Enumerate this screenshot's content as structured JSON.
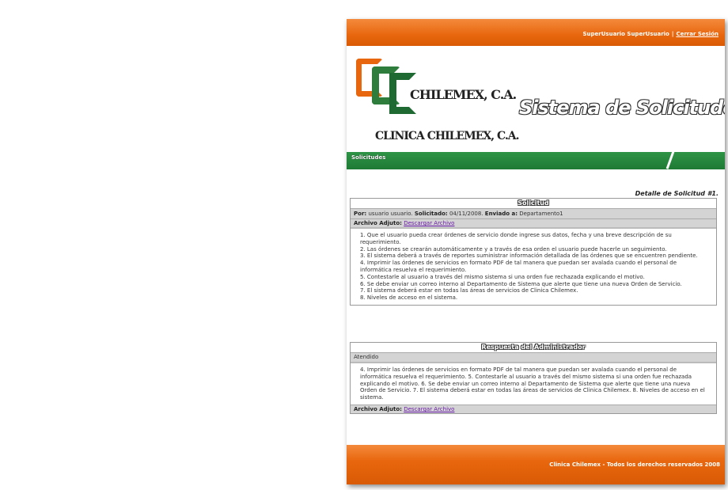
{
  "topbar": {
    "user": "SuperUsuario SuperUsuario",
    "separator": "|",
    "logout": "Cerrar Sesión"
  },
  "header": {
    "logo_name": "CHILEMEX, C.A.",
    "logo_sub": "CLINICA CHILEMEX, C.A.",
    "title": "Sistema de Solicitudes"
  },
  "nav": {
    "tab": "Solicitudes"
  },
  "detail": {
    "title": "Detalle de Solicitud #1.",
    "request_heading": "Solicitud",
    "por_label": "Por:",
    "por_value": "usuario usuario.",
    "solicitado_label": "Solicitado:",
    "solicitado_value": "04/11/2008.",
    "enviado_label": "Enviado a:",
    "enviado_value": "Departamento1",
    "attach_label": "Archivo Adjuto:",
    "attach_link": "Descargar Archivo",
    "request_lines": [
      "1. Que el usuario pueda crear órdenes de servicio donde ingrese sus datos, fecha y una breve descripción de su requerimiento.",
      "2. Las órdenes se crearán automáticamente y a través de esa orden el usuario puede hacerle un seguimiento.",
      "3. El sistema deberá a través de reportes suministrar información detallada de las órdenes que se encuentren pendiente.",
      "4. Imprimir las órdenes de servicios en formato PDF de tal manera que puedan ser avalada cuando el personal de informática resuelva el requerimiento.",
      "5. Contestarle al usuario a través del mismo sistema si una orden fue rechazada explicando el motivo.",
      "6. Se debe enviar un correo interno al Departamento de Sistema que alerte que tiene una nueva Orden de Servicio.",
      "7. El sistema deberá estar en todas las áreas de servicios de Clinica Chilemex.",
      "8. Niveles de acceso en el sistema."
    ],
    "response_heading": "Respuesta del Administrador",
    "status": "Atendido",
    "response_text": "4. Imprimir las órdenes de servicios en formato PDF de tal manera que puedan ser avalada cuando el personal de informática resuelva el requerimiento. 5. Contestarle al usuario a través del mismo sistema si una orden fue rechazada explicando el motivo. 6. Se debe enviar un correo interno al Departamento de Sistema que alerte que tiene una nueva Orden de Servicio. 7. El sistema deberá estar en todas las áreas de servicios de Clinica Chilemex. 8. Niveles de acceso en el sistema.",
    "response_attach_label": "Archivo Adjuto:",
    "response_attach_link": "Descargar Archivo"
  },
  "footer": {
    "text": "Clinica Chilemex - Todos los derechos reservados 2008"
  },
  "colors": {
    "orange": "#e8670e",
    "green": "#1e7a34",
    "link": "#6a1aa8"
  }
}
